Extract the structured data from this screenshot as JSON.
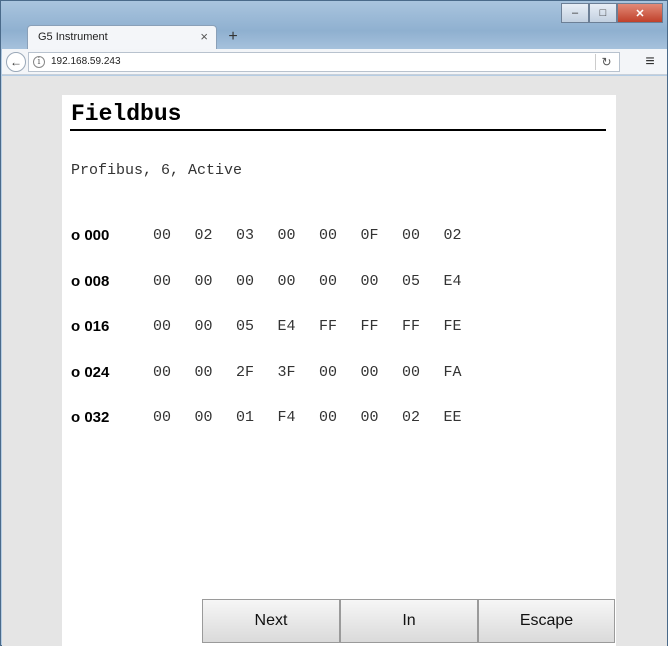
{
  "browser": {
    "tab_title": "G5 Instrument",
    "tab_close_glyph": "×",
    "new_tab_glyph": "+",
    "url": "192.168.59.243",
    "icons": {
      "back": "back-arrow-icon",
      "info": "info-icon",
      "reload": "reload-icon",
      "menu": "hamburger-menu-icon",
      "minimize": "minimize-icon",
      "maximize": "maximize-icon",
      "close": "close-icon"
    }
  },
  "page": {
    "title": "Fieldbus",
    "status": "Profibus, 6, Active",
    "rows": [
      {
        "addr": "o 000",
        "cells": [
          "00",
          "02",
          "03",
          "00",
          "00",
          "0F",
          "00",
          "02"
        ]
      },
      {
        "addr": "o 008",
        "cells": [
          "00",
          "00",
          "00",
          "00",
          "00",
          "00",
          "05",
          "E4"
        ]
      },
      {
        "addr": "o 016",
        "cells": [
          "00",
          "00",
          "05",
          "E4",
          "FF",
          "FF",
          "FF",
          "FE"
        ]
      },
      {
        "addr": "o 024",
        "cells": [
          "00",
          "00",
          "2F",
          "3F",
          "00",
          "00",
          "00",
          "FA"
        ]
      },
      {
        "addr": "o 032",
        "cells": [
          "00",
          "00",
          "01",
          "F4",
          "00",
          "00",
          "02",
          "EE"
        ]
      }
    ],
    "buttons": {
      "next": "Next",
      "in": "In",
      "escape": "Escape"
    }
  },
  "colors": {
    "title_rule": "#000000",
    "panel_bg": "#ffffff",
    "viewport_bg": "#e5e5e5"
  }
}
